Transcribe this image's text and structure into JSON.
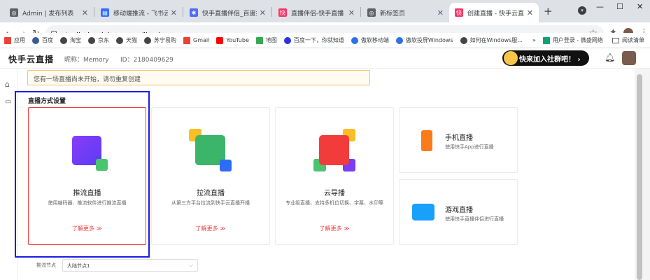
{
  "tabs": [
    {
      "title": "Admin | 发布列表",
      "color": "#5f6368",
      "glyph": "◎"
    },
    {
      "title": "移动端推流 - 飞书云文档",
      "color": "#3370ff",
      "glyph": "▤"
    },
    {
      "title": "快手直播伴侣_百度搜索",
      "color": "#4e6ef2",
      "glyph": "✱"
    },
    {
      "title": "直播伴侣-快手直播",
      "color": "#fe3666",
      "glyph": "快"
    },
    {
      "title": "新标签页",
      "color": "#5f6368",
      "glyph": "◎"
    },
    {
      "title": "创建直播 - 快手云直播",
      "color": "#fe3666",
      "glyph": "快"
    }
  ],
  "address": {
    "url": "studio.kuaishou.com/live/new"
  },
  "bookmarks": [
    {
      "label": "应用",
      "color": "#ea4335"
    },
    {
      "label": "百度",
      "color": "#3b5998"
    },
    {
      "label": "淘宝",
      "color": "#444"
    },
    {
      "label": "京东",
      "color": "#444"
    },
    {
      "label": "天猫",
      "color": "#444"
    },
    {
      "label": "苏宁易购",
      "color": "#444"
    },
    {
      "label": "Gmail",
      "color": "#ea4335"
    },
    {
      "label": "YouTube",
      "color": "#ff0000"
    },
    {
      "label": "地图",
      "color": "#34a853"
    },
    {
      "label": "百度一下，你就知道",
      "color": "#2932e1"
    },
    {
      "label": "傲软移动端",
      "color": "#2f6fe8"
    },
    {
      "label": "傲软投屏Windows",
      "color": "#2f6fe8"
    },
    {
      "label": "如何在Windows服...",
      "color": "#444"
    }
  ],
  "bookmarks_right": [
    {
      "label": "用户登录 - 微盛网络",
      "color": "#12a26e"
    }
  ],
  "reading_list": "阅读清单",
  "app": {
    "logo": "快手云直播",
    "nickname_label": "昵称：",
    "nickname": "Memory",
    "id_label": "ID：",
    "id": "2180409629",
    "banner": "快来加入社群吧！ ›"
  },
  "notice": "您有一场直播尚未开始，请勿重复创建",
  "section_title": "直播方式设置",
  "cards": [
    {
      "title": "推流直播",
      "desc": "使用编码器、推流软件进行推流直播",
      "link": "了解更多 ≫"
    },
    {
      "title": "拉流直播",
      "desc": "从第三方平台拉流到快手云直播开播",
      "link": "了解更多 ≫"
    },
    {
      "title": "云导播",
      "desc": "专业级直播，支持多机位切换、字幕、水印等",
      "link": "了解更多 ≫"
    }
  ],
  "side_cards": [
    {
      "title": "手机直播",
      "desc": "使用快手App进行直播"
    },
    {
      "title": "游戏直播",
      "desc": "使用快手直播伴侣进行直播"
    }
  ],
  "node": {
    "label": "推流节点",
    "value": "大陆节点1"
  },
  "colors": {
    "accent": "#f03c3c",
    "selection": "#1c1ce0",
    "purple": "#7b3cf5",
    "green": "#3bb56a",
    "yellow": "#fbbf24",
    "red": "#f23c3c",
    "blue": "#2f6cf6",
    "orange": "#fb7a1a",
    "sky": "#18a0fb"
  }
}
